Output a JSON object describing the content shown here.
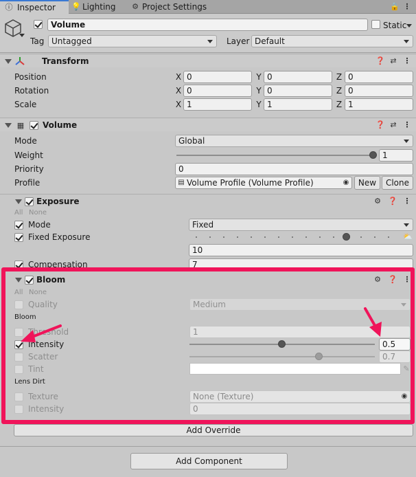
{
  "tabs": [
    {
      "label": "Inspector",
      "active": true
    },
    {
      "label": "Lighting"
    },
    {
      "label": "Project Settings"
    }
  ],
  "gameobject": {
    "name": "Volume",
    "static_label": "Static",
    "tag_label": "Tag",
    "tag_value": "Untagged",
    "layer_label": "Layer",
    "layer_value": "Default"
  },
  "transform": {
    "title": "Transform",
    "rows": [
      {
        "label": "Position",
        "x": "0",
        "y": "0",
        "z": "0"
      },
      {
        "label": "Rotation",
        "x": "0",
        "y": "0",
        "z": "0"
      },
      {
        "label": "Scale",
        "x": "1",
        "y": "1",
        "z": "1"
      }
    ]
  },
  "volume": {
    "title": "Volume",
    "mode_label": "Mode",
    "mode_value": "Global",
    "weight_label": "Weight",
    "weight_value": "1",
    "weight_level": 1.0,
    "priority_label": "Priority",
    "priority_value": "0",
    "profile_label": "Profile",
    "profile_value": "Volume Profile (Volume Profile)",
    "new_label": "New",
    "clone_label": "Clone"
  },
  "exposure": {
    "title": "Exposure",
    "all": "All",
    "none": "None",
    "mode_label": "Mode",
    "mode_value": "Fixed",
    "fixed_label": "Fixed Exposure",
    "fixed_value": "10",
    "comp_label": "Compensation",
    "comp_value": "7"
  },
  "bloom": {
    "title": "Bloom",
    "all": "All",
    "none": "None",
    "quality_label": "Quality",
    "quality_value": "Medium",
    "section_bloom": "Bloom",
    "threshold_label": "Threshold",
    "threshold_value": "1",
    "intensity_label": "Intensity",
    "intensity_value": "0.5",
    "intensity_level": 0.5,
    "scatter_label": "Scatter",
    "scatter_value": "0.7",
    "scatter_level": 0.7,
    "tint_label": "Tint",
    "section_lens": "Lens Dirt",
    "texture_label": "Texture",
    "texture_value": "None (Texture)",
    "lens_intensity_label": "Intensity",
    "lens_intensity_value": "0"
  },
  "add_override": "Add Override",
  "add_component": "Add Component",
  "colors": {
    "highlight": "#f0145a",
    "background": "#c8c8c8"
  }
}
